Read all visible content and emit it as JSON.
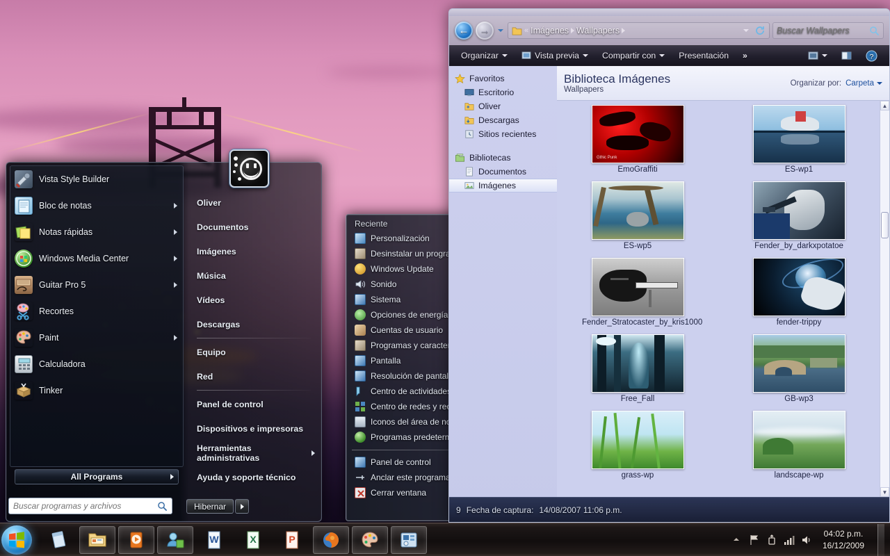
{
  "desktop": {
    "wallpaper_name": "pink-sunset-bridge-city-wallpaper",
    "colors": {
      "sky_top": "#c77ca8",
      "sky_mid": "#e7a2c4",
      "ground_dark": "#160c22"
    }
  },
  "start_menu": {
    "user_avatar_name": "Oliver",
    "programs": [
      {
        "label": "Vista Style Builder",
        "icon": "wrench-paint-icon",
        "has_submenu": false
      },
      {
        "label": "Bloc de notas",
        "icon": "notepad-icon",
        "has_submenu": true
      },
      {
        "label": "Notas rápidas",
        "icon": "sticky-notes-icon",
        "has_submenu": true
      },
      {
        "label": "Windows Media Center",
        "icon": "media-center-icon",
        "has_submenu": true
      },
      {
        "label": "Guitar Pro 5",
        "icon": "guitar-pro-icon",
        "has_submenu": true
      },
      {
        "label": "Recortes",
        "icon": "snipping-tool-icon",
        "has_submenu": false
      },
      {
        "label": "Paint",
        "icon": "paint-palette-icon",
        "has_submenu": true
      },
      {
        "label": "Calculadora",
        "icon": "calculator-icon",
        "has_submenu": false
      },
      {
        "label": "Tinker",
        "icon": "tinker-box-icon",
        "has_submenu": false
      }
    ],
    "all_programs_label": "All Programs",
    "search": {
      "placeholder": "Buscar programas y archivos",
      "value": ""
    },
    "places": [
      {
        "label": "Oliver",
        "has_submenu": false,
        "separator_after": false
      },
      {
        "label": "Documentos",
        "has_submenu": false,
        "separator_after": false
      },
      {
        "label": "Imágenes",
        "has_submenu": false,
        "separator_after": false
      },
      {
        "label": "Música",
        "has_submenu": false,
        "separator_after": false
      },
      {
        "label": "Vídeos",
        "has_submenu": false,
        "separator_after": false
      },
      {
        "label": "Descargas",
        "has_submenu": false,
        "separator_after": true
      },
      {
        "label": "Equipo",
        "has_submenu": false,
        "separator_after": false
      },
      {
        "label": "Red",
        "has_submenu": false,
        "separator_after": true
      },
      {
        "label": "Panel de control",
        "has_submenu": false,
        "separator_after": false
      },
      {
        "label": "Dispositivos e impresoras",
        "has_submenu": false,
        "separator_after": false
      },
      {
        "label": "Herramientas administrativas",
        "has_submenu": true,
        "separator_after": false
      },
      {
        "label": "Ayuda y soporte técnico",
        "has_submenu": false,
        "separator_after": false
      }
    ],
    "power": {
      "label": "Hibernar"
    }
  },
  "jumplist": {
    "section_title": "Reciente",
    "recent_items": [
      {
        "label": "Personalización",
        "icon": "personalization-icon"
      },
      {
        "label": "Desinstalar un programa",
        "icon": "uninstall-program-icon"
      },
      {
        "label": "Windows Update",
        "icon": "windows-update-icon"
      },
      {
        "label": "Sonido",
        "icon": "sound-speaker-icon"
      },
      {
        "label": "Sistema",
        "icon": "system-icon"
      },
      {
        "label": "Opciones de energía",
        "icon": "power-options-icon"
      },
      {
        "label": "Cuentas de usuario",
        "icon": "user-accounts-icon"
      },
      {
        "label": "Programas y características",
        "icon": "programs-features-icon"
      },
      {
        "label": "Pantalla",
        "icon": "display-icon"
      },
      {
        "label": "Resolución de pantalla",
        "icon": "screen-resolution-icon"
      },
      {
        "label": "Centro de actividades",
        "icon": "action-center-icon"
      },
      {
        "label": "Centro de redes y recursos compartidos",
        "icon": "network-sharing-center-icon"
      },
      {
        "label": "Iconos del área de notificación",
        "icon": "notification-area-icons-icon"
      },
      {
        "label": "Programas predeterminados",
        "icon": "default-programs-icon"
      }
    ],
    "actions": [
      {
        "label": "Panel de control",
        "icon": "control-panel-icon"
      },
      {
        "label": "Anclar este programa a la barra de tareas",
        "icon": "pin-icon"
      },
      {
        "label": "Cerrar ventana",
        "icon": "close-window-icon"
      }
    ]
  },
  "explorer": {
    "address": {
      "breadcrumbs": [
        "Imágenes",
        "Wallpapers"
      ],
      "overflow": "«",
      "folder_icon": "folder-icon"
    },
    "search": {
      "placeholder": "Buscar Wallpapers",
      "value": ""
    },
    "toolbar": [
      {
        "label": "Organizar",
        "dropdown": true,
        "icon": null
      },
      {
        "label": "Vista previa",
        "dropdown": true,
        "icon": "preview-icon"
      },
      {
        "label": "Compartir con",
        "dropdown": true,
        "icon": null
      },
      {
        "label": "Presentación",
        "dropdown": false,
        "icon": null
      },
      {
        "label": "»",
        "dropdown": false,
        "icon": null
      }
    ],
    "toolbar_right": [
      {
        "name": "change-view-button",
        "icon": "view-icon",
        "dropdown": true
      },
      {
        "name": "show-preview-pane-button",
        "icon": "preview-pane-icon",
        "dropdown": false
      },
      {
        "name": "help-button",
        "icon": "help-icon",
        "dropdown": false
      }
    ],
    "navigation_pane": [
      {
        "label": "Favoritos",
        "icon": "star-icon",
        "level": 0,
        "selected": false
      },
      {
        "label": "Escritorio",
        "icon": "desktop-icon",
        "level": 1,
        "selected": false
      },
      {
        "label": "Oliver",
        "icon": "user-folder-icon",
        "level": 1,
        "selected": false
      },
      {
        "label": "Descargas",
        "icon": "downloads-folder-icon",
        "level": 1,
        "selected": false
      },
      {
        "label": "Sitios recientes",
        "icon": "recent-places-icon",
        "level": 1,
        "selected": false
      },
      {
        "label": "Bibliotecas",
        "icon": "libraries-icon",
        "level": 0,
        "selected": false
      },
      {
        "label": "Documentos",
        "icon": "documents-library-icon",
        "level": 1,
        "selected": false
      },
      {
        "label": "Imágenes",
        "icon": "pictures-library-icon",
        "level": 1,
        "selected": true
      }
    ],
    "library": {
      "title": "Biblioteca Imágenes",
      "subtitle": "Wallpapers",
      "arrange_label": "Organizar por:",
      "arrange_value": "Carpeta"
    },
    "items": [
      {
        "name": "EmoGraffiti",
        "thumb": "emo-graffiti-red-thumb"
      },
      {
        "name": "ES-wp1",
        "thumb": "guggenheim-bilbao-thumb"
      },
      {
        "name": "ES-wp5",
        "thumb": "tree-coast-thumb"
      },
      {
        "name": "Fender_by_darkxpotatoe",
        "thumb": "fender-guitar-thumb"
      },
      {
        "name": "Fender_Stratocaster_by_kris1000",
        "thumb": "stratocaster-grayscale-thumb"
      },
      {
        "name": "fender-trippy",
        "thumb": "fender-trippy-thumb"
      },
      {
        "name": "Free_Fall",
        "thumb": "bridge-underside-thumb"
      },
      {
        "name": "GB-wp3",
        "thumb": "stone-bridge-river-thumb"
      },
      {
        "name": "grass-wp",
        "thumb": "green-grass-thumb"
      },
      {
        "name": "landscape-wp",
        "thumb": "green-landscape-thumb"
      }
    ],
    "status_bar": {
      "prefix": "9",
      "label": "Fecha de captura:",
      "value": "14/08/2007 11:06 p.m."
    },
    "scrollbar": {
      "up_glyph": "▲",
      "down_glyph": "▼"
    }
  },
  "taskbar": {
    "start_button": "start-orb",
    "buttons": [
      {
        "name": "taskbar-notepad",
        "icon": "notepad-icon",
        "active": false
      },
      {
        "name": "taskbar-explorer",
        "icon": "explorer-folder-icon",
        "active": true
      },
      {
        "name": "taskbar-media-player",
        "icon": "windows-media-player-icon",
        "active": true
      },
      {
        "name": "taskbar-messenger",
        "icon": "windows-live-messenger-icon",
        "active": true
      },
      {
        "name": "taskbar-word",
        "icon": "microsoft-word-icon",
        "active": false
      },
      {
        "name": "taskbar-excel",
        "icon": "microsoft-excel-icon",
        "active": false
      },
      {
        "name": "taskbar-powerpoint",
        "icon": "microsoft-powerpoint-icon",
        "active": false
      },
      {
        "name": "taskbar-firefox",
        "icon": "firefox-icon",
        "active": true
      },
      {
        "name": "taskbar-paint",
        "icon": "paint-palette-icon",
        "active": true
      },
      {
        "name": "taskbar-control-panel",
        "icon": "control-panel-icon",
        "active": true
      }
    ],
    "tray": [
      {
        "name": "show-hidden-icons",
        "icon": "chevron-up-icon"
      },
      {
        "name": "action-center-flag",
        "icon": "flag-icon"
      },
      {
        "name": "safely-remove-hardware",
        "icon": "usb-eject-icon"
      },
      {
        "name": "network-icon",
        "icon": "network-bars-icon"
      },
      {
        "name": "volume-icon",
        "icon": "speaker-icon"
      }
    ],
    "clock": {
      "time": "04:02 p.m.",
      "date": "16/12/2009"
    }
  }
}
